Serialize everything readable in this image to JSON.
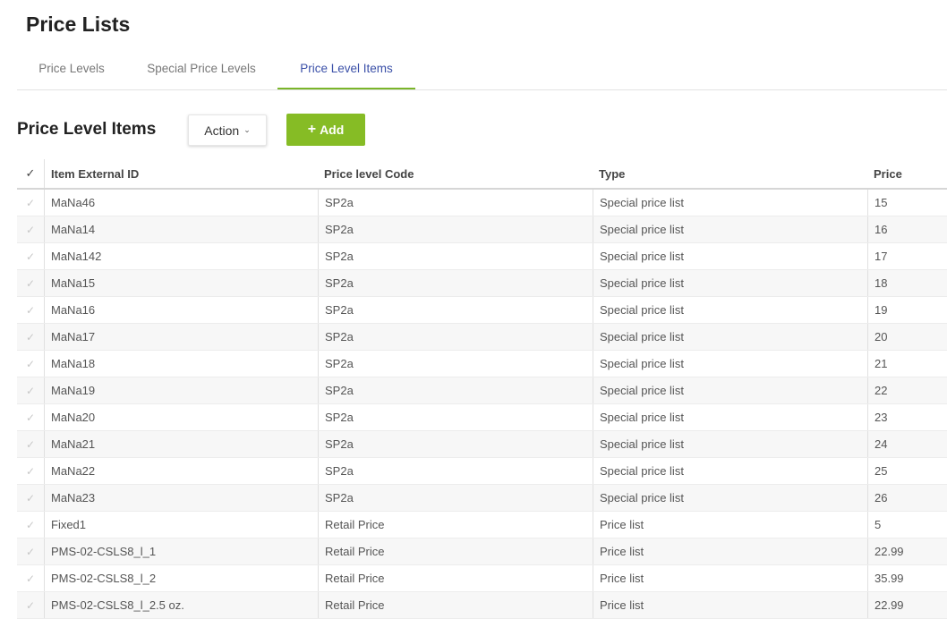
{
  "page": {
    "title": "Price Lists"
  },
  "tabs": [
    {
      "label": "Price Levels",
      "active": false
    },
    {
      "label": "Special Price Levels",
      "active": false
    },
    {
      "label": "Price Level Items",
      "active": true
    }
  ],
  "section": {
    "title": "Price Level Items"
  },
  "toolbar": {
    "action_label": "Action",
    "add_label": "Add"
  },
  "colors": {
    "accent_green": "#86bc25",
    "active_tab_text": "#3b50a8"
  },
  "icons": {
    "row_check": "check-icon",
    "action_chevron": "chevron-down-icon",
    "add": "plus-icon"
  },
  "table": {
    "columns": [
      "Item External ID",
      "Price level Code",
      "Type",
      "Price"
    ],
    "rows": [
      [
        "MaNa46",
        "SP2a",
        "Special price list",
        "15"
      ],
      [
        "MaNa14",
        "SP2a",
        "Special price list",
        "16"
      ],
      [
        "MaNa142",
        "SP2a",
        "Special price list",
        "17"
      ],
      [
        "MaNa15",
        "SP2a",
        "Special price list",
        "18"
      ],
      [
        "MaNa16",
        "SP2a",
        "Special price list",
        "19"
      ],
      [
        "MaNa17",
        "SP2a",
        "Special price list",
        "20"
      ],
      [
        "MaNa18",
        "SP2a",
        "Special price list",
        "21"
      ],
      [
        "MaNa19",
        "SP2a",
        "Special price list",
        "22"
      ],
      [
        "MaNa20",
        "SP2a",
        "Special price list",
        "23"
      ],
      [
        "MaNa21",
        "SP2a",
        "Special price list",
        "24"
      ],
      [
        "MaNa22",
        "SP2a",
        "Special price list",
        "25"
      ],
      [
        "MaNa23",
        "SP2a",
        "Special price list",
        "26"
      ],
      [
        "Fixed1",
        "Retail Price",
        "Price list",
        "5"
      ],
      [
        "PMS-02-CSLS8_l_1",
        "Retail Price",
        "Price list",
        "22.99"
      ],
      [
        "PMS-02-CSLS8_l_2",
        "Retail Price",
        "Price list",
        "35.99"
      ],
      [
        "PMS-02-CSLS8_l_2.5 oz.",
        "Retail Price",
        "Price list",
        "22.99"
      ]
    ]
  }
}
